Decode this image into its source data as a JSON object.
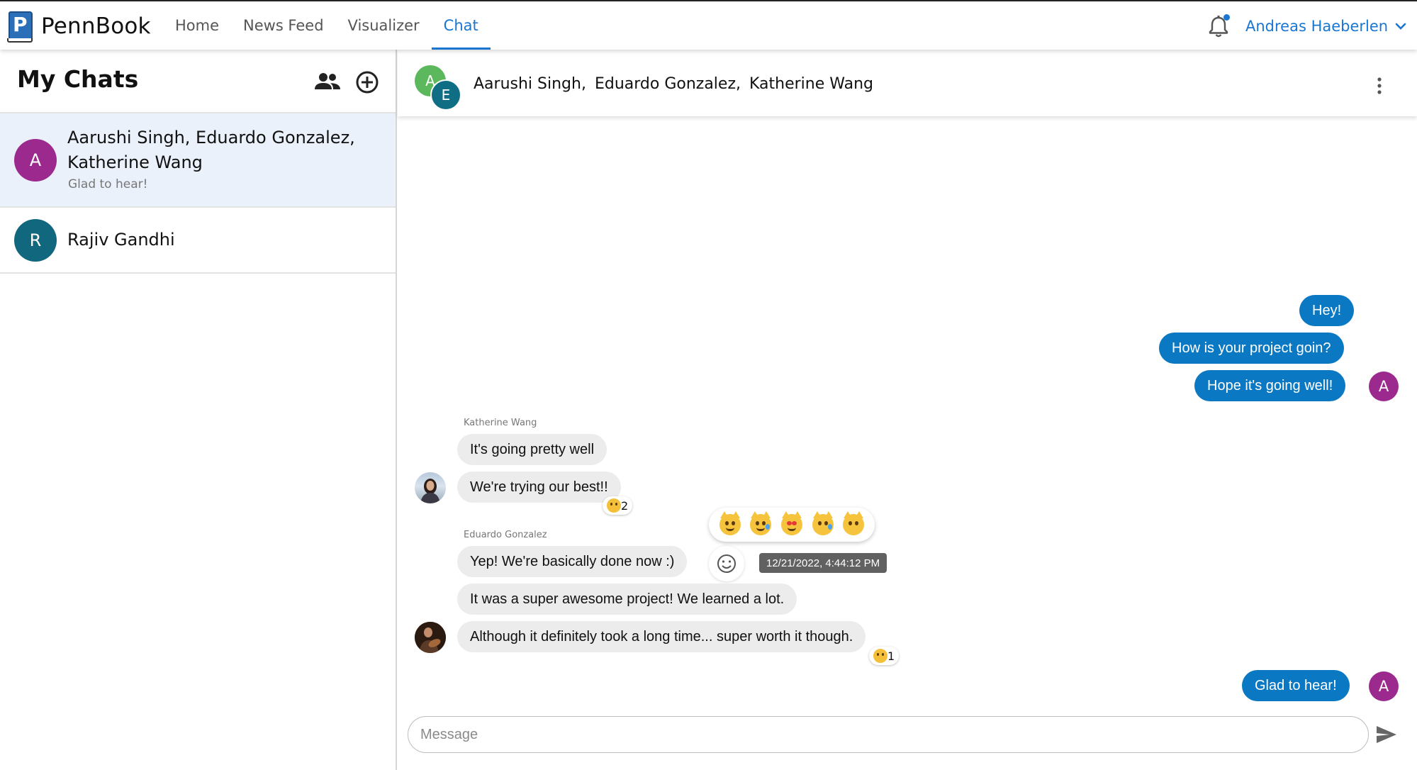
{
  "app": {
    "brand": "PennBook",
    "logo_letter": "P"
  },
  "nav": {
    "tabs": [
      {
        "label": "Home",
        "active": false
      },
      {
        "label": "News Feed",
        "active": false
      },
      {
        "label": "Visualizer",
        "active": false
      },
      {
        "label": "Chat",
        "active": true
      }
    ]
  },
  "user": {
    "name": "Andreas Haeberlen",
    "has_notification": true
  },
  "sidebar": {
    "title": "My Chats",
    "chats": [
      {
        "avatar_letter": "A",
        "avatar_color": "#9c2a8e",
        "name": "Aarushi Singh, Eduardo Gonzalez, Katherine Wang",
        "preview": "Glad to hear!",
        "selected": true
      },
      {
        "avatar_letter": "R",
        "avatar_color": "#11677d",
        "name": "Rajiv Gandhi",
        "preview": "",
        "selected": false
      }
    ]
  },
  "chat": {
    "header": {
      "avatars": [
        {
          "letter": "A",
          "color": "#5cb85c"
        },
        {
          "letter": "E",
          "color": "#0f6e84"
        }
      ],
      "members": [
        "Aarushi Singh,",
        "Eduardo Gonzalez,",
        "Katherine Wang"
      ]
    },
    "messages": {
      "out": [
        {
          "text": "Hey!"
        },
        {
          "text": "How is your project goin?"
        },
        {
          "text": "Hope it's going well!"
        },
        {
          "text": "Glad to hear!"
        }
      ],
      "katherine": {
        "sender": "Katherine Wang",
        "texts": [
          "It's going pretty well",
          "We're trying our best!!"
        ],
        "reaction_count": "2"
      },
      "eduardo": {
        "sender": "Eduardo Gonzalez",
        "texts": [
          "Yep! We're basically done now :)",
          "It was a super awesome project! We learned a lot.",
          "Although it definitely took a long time... super worth it though."
        ],
        "reaction_count": "1"
      },
      "self_avatar_letter": "A",
      "self_avatar_color": "#9c2a8e"
    },
    "reaction_picker": [
      "smiling-cat",
      "cat-tears-of-joy",
      "heart-eyes-cat",
      "crying-cat",
      "pouting-cat"
    ],
    "hover_timestamp": "12/21/2022, 4:44:12 PM",
    "composer": {
      "placeholder": "Message",
      "value": ""
    }
  },
  "colors": {
    "accent": "#1976d2",
    "outgoing_bubble": "#0a78c2",
    "incoming_bubble": "#ececec",
    "selected_chat": "#eaf1fb"
  }
}
